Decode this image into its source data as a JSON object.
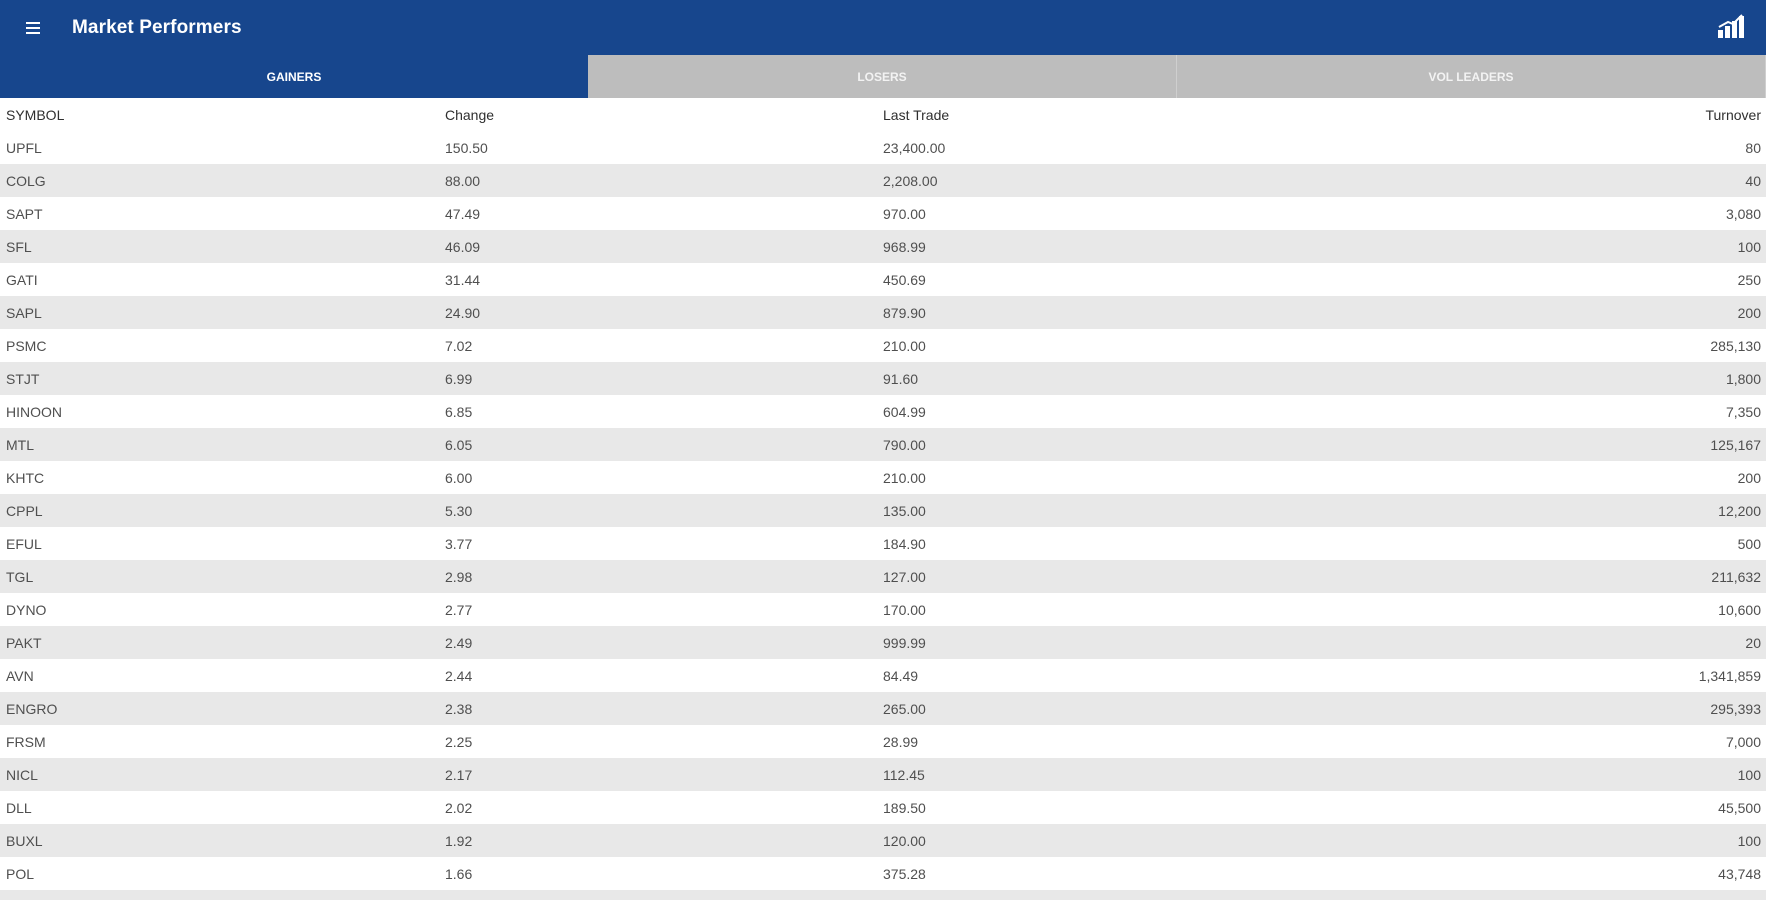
{
  "header": {
    "title": "Market Performers",
    "menu_icon": "hamburger-menu-icon",
    "right_icon": "bar-chart-icon",
    "brand_color": "#17468d"
  },
  "tabs": [
    {
      "label": "GAINERS",
      "active": true
    },
    {
      "label": "LOSERS",
      "active": false
    },
    {
      "label": "VOL LEADERS",
      "active": false
    }
  ],
  "table": {
    "columns": [
      "SYMBOL",
      "Change",
      "Last Trade",
      "Turnover"
    ],
    "rows": [
      [
        "UPFL",
        "150.50",
        "23,400.00",
        "80"
      ],
      [
        "COLG",
        "88.00",
        "2,208.00",
        "40"
      ],
      [
        "SAPT",
        "47.49",
        "970.00",
        "3,080"
      ],
      [
        "SFL",
        "46.09",
        "968.99",
        "100"
      ],
      [
        "GATI",
        "31.44",
        "450.69",
        "250"
      ],
      [
        "SAPL",
        "24.90",
        "879.90",
        "200"
      ],
      [
        "PSMC",
        "7.02",
        "210.00",
        "285,130"
      ],
      [
        "STJT",
        "6.99",
        "91.60",
        "1,800"
      ],
      [
        "HINOON",
        "6.85",
        "604.99",
        "7,350"
      ],
      [
        "MTL",
        "6.05",
        "790.00",
        "125,167"
      ],
      [
        "KHTC",
        "6.00",
        "210.00",
        "200"
      ],
      [
        "CPPL",
        "5.30",
        "135.00",
        "12,200"
      ],
      [
        "EFUL",
        "3.77",
        "184.90",
        "500"
      ],
      [
        "TGL",
        "2.98",
        "127.00",
        "211,632"
      ],
      [
        "DYNO",
        "2.77",
        "170.00",
        "10,600"
      ],
      [
        "PAKT",
        "2.49",
        "999.99",
        "20"
      ],
      [
        "AVN",
        "2.44",
        "84.49",
        "1,341,859"
      ],
      [
        "ENGRO",
        "2.38",
        "265.00",
        "295,393"
      ],
      [
        "FRSM",
        "2.25",
        "28.99",
        "7,000"
      ],
      [
        "NICL",
        "2.17",
        "112.45",
        "100"
      ],
      [
        "DLL",
        "2.02",
        "189.50",
        "45,500"
      ],
      [
        "BUXL",
        "1.92",
        "120.00",
        "100"
      ],
      [
        "POL",
        "1.66",
        "375.28",
        "43,748"
      ],
      [
        "",
        "",
        "",
        ""
      ]
    ]
  }
}
